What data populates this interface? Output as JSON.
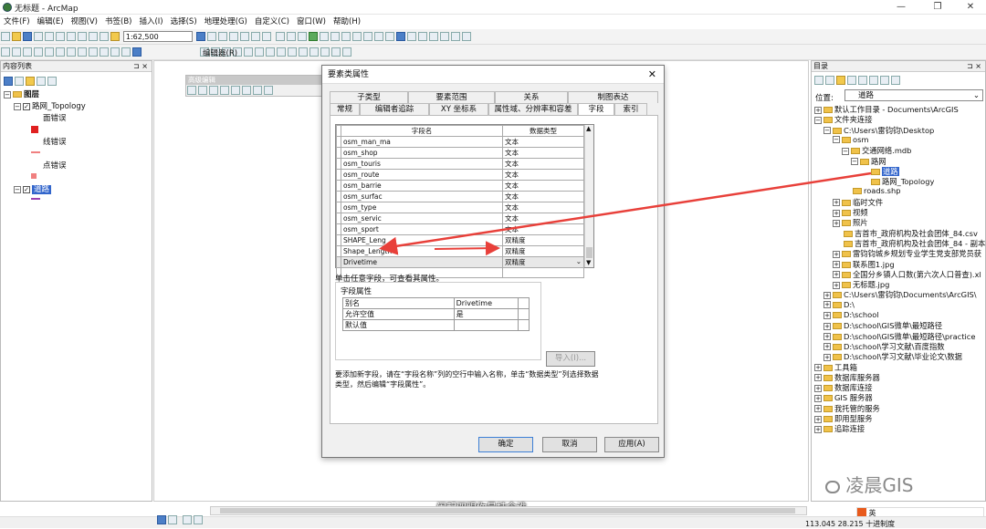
{
  "window": {
    "title": "无标题 - ArcMap",
    "min": "—",
    "restore": "❐",
    "close": "✕"
  },
  "menu": [
    "文件(F)",
    "编辑(E)",
    "视图(V)",
    "书签(B)",
    "插入(I)",
    "选择(S)",
    "地理处理(G)",
    "自定义(C)",
    "窗口(W)",
    "帮助(H)"
  ],
  "toolbar": {
    "scale": "1:62,500",
    "editor": "编辑器(R)"
  },
  "toc": {
    "title": "内容列表",
    "pin": "⊐ ×",
    "layers_root": "图层",
    "topology": "路网_Topology",
    "legend": [
      "面错误",
      "线错误",
      "点错误"
    ],
    "roads": "道路"
  },
  "advanced_edit": {
    "title": "高级编辑"
  },
  "dialog": {
    "title": "要素类属性",
    "close": "✕",
    "tabs_top": [
      "子类型",
      "要素范围",
      "关系",
      "制图表达"
    ],
    "tabs_bottom": [
      "常规",
      "编辑者追踪",
      "XY 坐标系",
      "属性域、分辨率和容差",
      "字段",
      "索引"
    ],
    "grid_headers": [
      "字段名",
      "数据类型"
    ],
    "fields": [
      {
        "name": "osm_man_ma",
        "type": "文本"
      },
      {
        "name": "osm_shop",
        "type": "文本"
      },
      {
        "name": "osm_touris",
        "type": "文本"
      },
      {
        "name": "osm_route",
        "type": "文本"
      },
      {
        "name": "osm_barrie",
        "type": "文本"
      },
      {
        "name": "osm_surfac",
        "type": "文本"
      },
      {
        "name": "osm_type",
        "type": "文本"
      },
      {
        "name": "osm_servic",
        "type": "文本"
      },
      {
        "name": "osm_sport",
        "type": "文本"
      },
      {
        "name": "SHAPE_Leng",
        "type": "双精度"
      },
      {
        "name": "Shape_Length",
        "type": "双精度"
      },
      {
        "name": "Drivetime",
        "type": "双精度"
      }
    ],
    "hint_click": "单击任意字段，可查看其属性。",
    "field_props_label": "字段属性",
    "props": [
      {
        "k": "别名",
        "v": "Drivetime"
      },
      {
        "k": "允许空值",
        "v": "是"
      },
      {
        "k": "默认值",
        "v": ""
      }
    ],
    "import_btn": "导入(I)...",
    "instructions": "要添加新字段，请在“字段名称”列的空行中输入名称，单击“数据类型”列选择数据类型，然后编辑“字段属性”。",
    "ok": "确定",
    "cancel": "取消",
    "apply": "应用(A)"
  },
  "catalog": {
    "title": "目录",
    "location_label": "位置:",
    "location_value": "道路",
    "items": [
      {
        "t": "默认工作目录 - Documents\\ArcGIS",
        "lvl": 0,
        "exp": "+"
      },
      {
        "t": "文件夹连接",
        "lvl": 0,
        "exp": "−"
      },
      {
        "t": "C:\\Users\\雷钧钧\\Desktop",
        "lvl": 1,
        "exp": "−"
      },
      {
        "t": "osm",
        "lvl": 2,
        "exp": "−"
      },
      {
        "t": "交通网络.mdb",
        "lvl": 3,
        "exp": "−"
      },
      {
        "t": "路网",
        "lvl": 4,
        "exp": "−"
      },
      {
        "t": "道路",
        "lvl": 5,
        "exp": ""
      },
      {
        "t": "路网_Topology",
        "lvl": 5,
        "exp": ""
      },
      {
        "t": "roads.shp",
        "lvl": 3,
        "exp": ""
      },
      {
        "t": "临时文件",
        "lvl": 2,
        "exp": "+"
      },
      {
        "t": "视频",
        "lvl": 2,
        "exp": "+"
      },
      {
        "t": "照片",
        "lvl": 2,
        "exp": "+"
      },
      {
        "t": "吉首市_政府机构及社会团体_84.csv",
        "lvl": 2,
        "exp": ""
      },
      {
        "t": "吉首市_政府机构及社会团体_84 - 副本",
        "lvl": 2,
        "exp": ""
      },
      {
        "t": "雷钧钧城乡规划专业学生党支部党员获",
        "lvl": 2,
        "exp": "+"
      },
      {
        "t": "联系图1.jpg",
        "lvl": 2,
        "exp": "+"
      },
      {
        "t": "全国分乡镇人口数(第六次人口普查).xl",
        "lvl": 2,
        "exp": "+"
      },
      {
        "t": "无标题.jpg",
        "lvl": 2,
        "exp": "+"
      },
      {
        "t": "C:\\Users\\雷钧钧\\Documents\\ArcGIS\\",
        "lvl": 1,
        "exp": "+"
      },
      {
        "t": "D:\\",
        "lvl": 1,
        "exp": "+"
      },
      {
        "t": "D:\\school",
        "lvl": 1,
        "exp": "+"
      },
      {
        "t": "D:\\school\\GIS微单\\最短路径",
        "lvl": 1,
        "exp": "+"
      },
      {
        "t": "D:\\school\\GIS微单\\最短路径\\practice",
        "lvl": 1,
        "exp": "+"
      },
      {
        "t": "D:\\school\\学习文献\\百度指数",
        "lvl": 1,
        "exp": "+"
      },
      {
        "t": "D:\\school\\学习文献\\毕业论文\\数据",
        "lvl": 1,
        "exp": "+"
      },
      {
        "t": "工具箱",
        "lvl": 0,
        "exp": "+"
      },
      {
        "t": "数据库服务器",
        "lvl": 0,
        "exp": "+"
      },
      {
        "t": "数据库连接",
        "lvl": 0,
        "exp": "+"
      },
      {
        "t": "GIS 服务器",
        "lvl": 0,
        "exp": "+"
      },
      {
        "t": "我托管的服务",
        "lvl": 0,
        "exp": "+"
      },
      {
        "t": "即用型服务",
        "lvl": 0,
        "exp": "+"
      },
      {
        "t": "追踪连接",
        "lvl": 0,
        "exp": "+"
      }
    ]
  },
  "overlay": {
    "watermark": "凌晨GIS",
    "caption": "闹起双眼你最挂念谁",
    "ime": "英"
  },
  "status": {
    "coords": "113.045  28.215 十进制度"
  }
}
